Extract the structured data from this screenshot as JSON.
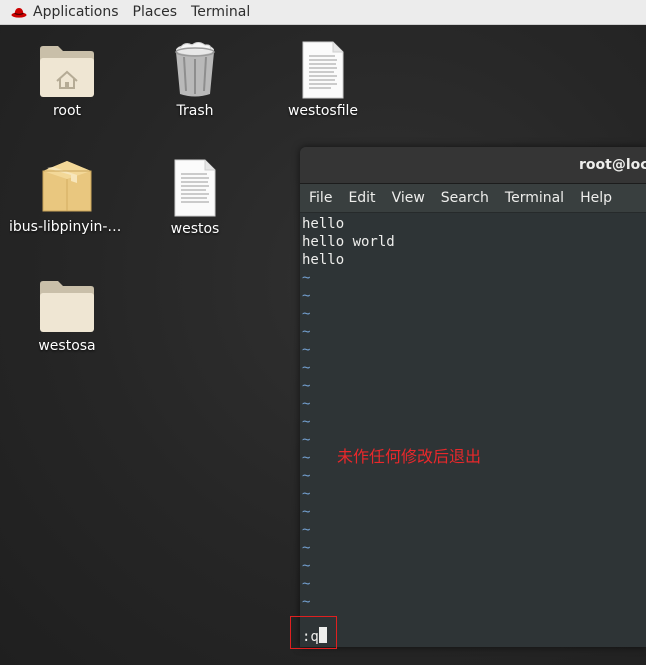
{
  "topbar": {
    "menus": [
      "Applications",
      "Places",
      "Terminal"
    ]
  },
  "desktop": {
    "icons": [
      {
        "label": "root",
        "icon": "home-folder-icon"
      },
      {
        "label": "Trash",
        "icon": "trash-icon"
      },
      {
        "label": "westosfile",
        "icon": "text-file-icon"
      },
      {
        "label": "ibus-libpinyin-1....",
        "icon": "package-icon"
      },
      {
        "label": "westos",
        "icon": "text-file-icon"
      },
      {
        "label": "westosa",
        "icon": "folder-icon"
      }
    ]
  },
  "terminal": {
    "title": "root@loca",
    "menu": [
      "File",
      "Edit",
      "View",
      "Search",
      "Terminal",
      "Help"
    ],
    "lines": [
      "hello",
      "hello world",
      "hello"
    ],
    "tilde": "~",
    "command": ":q"
  },
  "annotation": {
    "text": "未作任何修改后退出",
    "color": "#e8282b"
  },
  "colors": {
    "tilde": "#729fcf",
    "terminal_bg": "#2e3436",
    "highlight_border": "#e02020"
  }
}
